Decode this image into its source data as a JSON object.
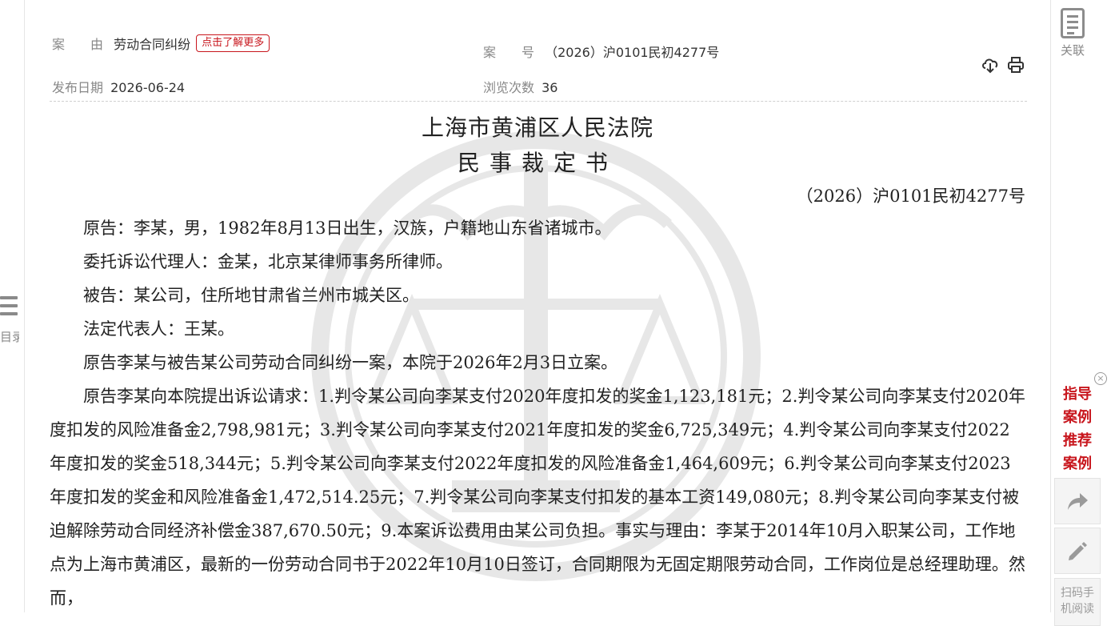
{
  "meta": {
    "cause_label": "案　　由",
    "cause_value": "劳动合同纠纷",
    "cause_badge": "点击了解更多",
    "caseno_label": "案　　号",
    "caseno_value": "（2026）沪0101民初4277号",
    "pubdate_label": "发布日期",
    "pubdate_value": "2026-06-24",
    "views_label": "浏览次数",
    "views_value": "36"
  },
  "sidebar_left": {
    "toc_label": "目录"
  },
  "sidebar_right": {
    "related_label": "关联",
    "guide_line1": "指导",
    "guide_line2": "案例",
    "guide_line3": "推荐",
    "guide_line4": "案例",
    "close_symbol": "×",
    "qr_line1": "扫码手",
    "qr_line2": "机阅读"
  },
  "document": {
    "court": "上海市黄浦区人民法院",
    "title": "民事裁定书",
    "case_number": "（2026）沪0101民初4277号",
    "paragraphs": [
      "原告：李某，男，1982年8月13日出生，汉族，户籍地山东省诸城市。",
      "委托诉讼代理人：金某，北京某律师事务所律师。",
      "被告：某公司，住所地甘肃省兰州市城关区。",
      "法定代表人：王某。",
      "原告李某与被告某公司劳动合同纠纷一案，本院于2026年2月3日立案。",
      "原告李某向本院提出诉讼请求：1.判令某公司向李某支付2020年度扣发的奖金1,123,181元；2.判令某公司向李某支付2020年度扣发的风险准备金2,798,981元；3.判令某公司向李某支付2021年度扣发的奖金6,725,349元；4.判令某公司向李某支付2022年度扣发的奖金518,344元；5.判令某公司向李某支付2022年度扣发的风险准备金1,464,609元；6.判令某公司向李某支付2023年度扣发的奖金和风险准备金1,472,514.25元；7.判令某公司向李某支付扣发的基本工资149,080元；8.判令某公司向李某支付被迫解除劳动合同经济补偿金387,670.50元；9.本案诉讼费用由某公司负担。事实与理由：李某于2014年10月入职某公司，工作地点为上海市黄浦区，最新的一份劳动合同书于2022年10月10日签订，合同期限为无固定期限劳动合同，工作岗位是总经理助理。然而，"
    ]
  },
  "icons": {
    "toc": "list-icon",
    "related": "document-icon",
    "download": "cloud-download-icon",
    "print": "printer-icon",
    "share": "share-icon",
    "edit": "pencil-icon",
    "watermark": "court-emblem-watermark"
  },
  "colors": {
    "accent": "#c8161d",
    "muted": "#888888",
    "text": "#222222"
  }
}
